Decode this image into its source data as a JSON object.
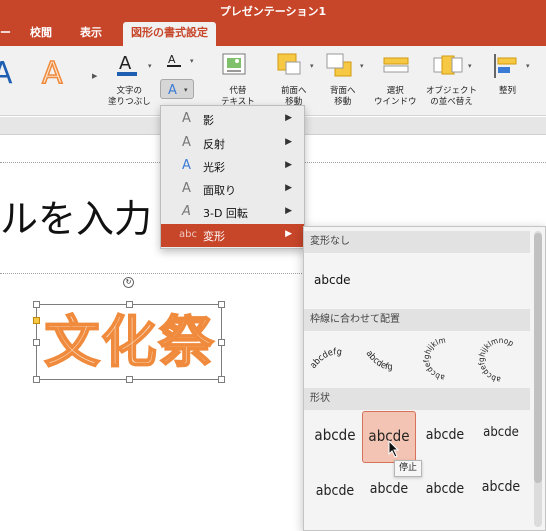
{
  "app": {
    "title": "プレゼンテーション1"
  },
  "tabs": [
    {
      "label": "ー"
    },
    {
      "label": "校閲"
    },
    {
      "label": "表示"
    },
    {
      "label": "図形の書式設定",
      "active": true
    }
  ],
  "ribbon": {
    "wordart_samples": [
      "A",
      "A"
    ],
    "text_fill_label": "文字の\n塗りつぶし",
    "alt_text_label": "代替\nテキスト",
    "bring_forward_label": "前面へ\n移動",
    "send_backward_label": "背面へ\n移動",
    "selection_pane_label": "選択\nウインドウ",
    "reorder_label": "オブジェクト\nの並べ替え",
    "align_label": "整列",
    "colors": {
      "text_fill": "#1f5fb2",
      "orange": "#f08a3c",
      "accent": "#c7462a"
    }
  },
  "slide": {
    "title_text": "ルを入力",
    "wordart_text": "文化祭"
  },
  "effects_menu": {
    "items": [
      {
        "icon": "shadow-a-icon",
        "label": "影"
      },
      {
        "icon": "reflection-a-icon",
        "label": "反射"
      },
      {
        "icon": "glow-a-icon",
        "label": "光彩"
      },
      {
        "icon": "bevel-a-icon",
        "label": "面取り"
      },
      {
        "icon": "3d-rotation-a-icon",
        "label": "3-D 回転"
      },
      {
        "icon": "transform-abc-icon",
        "label": "変形",
        "selected": true
      }
    ]
  },
  "transform_panel": {
    "sections": [
      {
        "title": "変形なし"
      },
      {
        "title": "枠線に合わせて配置"
      },
      {
        "title": "形状"
      }
    ],
    "no_transform_sample": "abcde",
    "follow_path_samples": [
      "abcdefg",
      "abcdefg",
      "abcdefghijklm",
      "abcdefghijklmnop"
    ],
    "warp_samples_row1": [
      "abcde",
      "abcde",
      "abcde",
      "abcde"
    ],
    "warp_samples_row2": [
      "abcde",
      "abcde",
      "abcde",
      "abcde"
    ],
    "tooltip": "停止"
  }
}
